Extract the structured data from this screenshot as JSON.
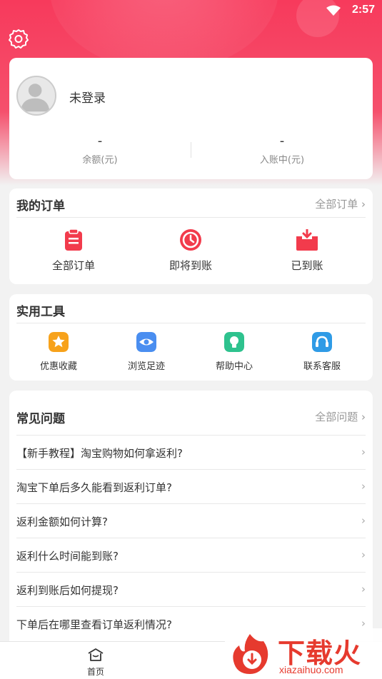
{
  "status_bar": {
    "time": "2:57"
  },
  "profile": {
    "login_status": "未登录",
    "balance_value": "-",
    "balance_label": "余额(元)",
    "pending_value": "-",
    "pending_label": "入账中(元)"
  },
  "orders": {
    "title": "我的订单",
    "more_label": "全部订单",
    "items": [
      {
        "label": "全部订单",
        "icon": "clipboard-icon"
      },
      {
        "label": "即将到账",
        "icon": "clock-icon"
      },
      {
        "label": "已到账",
        "icon": "inbox-download-icon"
      }
    ]
  },
  "tools": {
    "title": "实用工具",
    "items": [
      {
        "label": "优惠收藏",
        "icon": "star-icon",
        "color": "#f7a21b"
      },
      {
        "label": "浏览足迹",
        "icon": "eye-icon",
        "color": "#4a8ef0"
      },
      {
        "label": "帮助中心",
        "icon": "lightbulb-icon",
        "color": "#2ec28e"
      },
      {
        "label": "联系客服",
        "icon": "headset-icon",
        "color": "#2f9be6"
      }
    ]
  },
  "faq": {
    "title": "常见问题",
    "more_label": "全部问题",
    "items": [
      "【新手教程】淘宝购物如何拿返利?",
      "淘宝下单后多久能看到返利订单?",
      "返利金额如何计算?",
      "返利什么时间能到账?",
      "返利到账后如何提现?",
      "下单后在哪里查看订单返利情况?"
    ]
  },
  "tabbar": {
    "home_label": "首页"
  },
  "watermark": {
    "title": "下载火",
    "subtitle": "xiazaihuo.com"
  },
  "colors": {
    "brand": "#f73a5c",
    "order_icon": "#f23b4c",
    "watermark": "#e63a2e"
  }
}
